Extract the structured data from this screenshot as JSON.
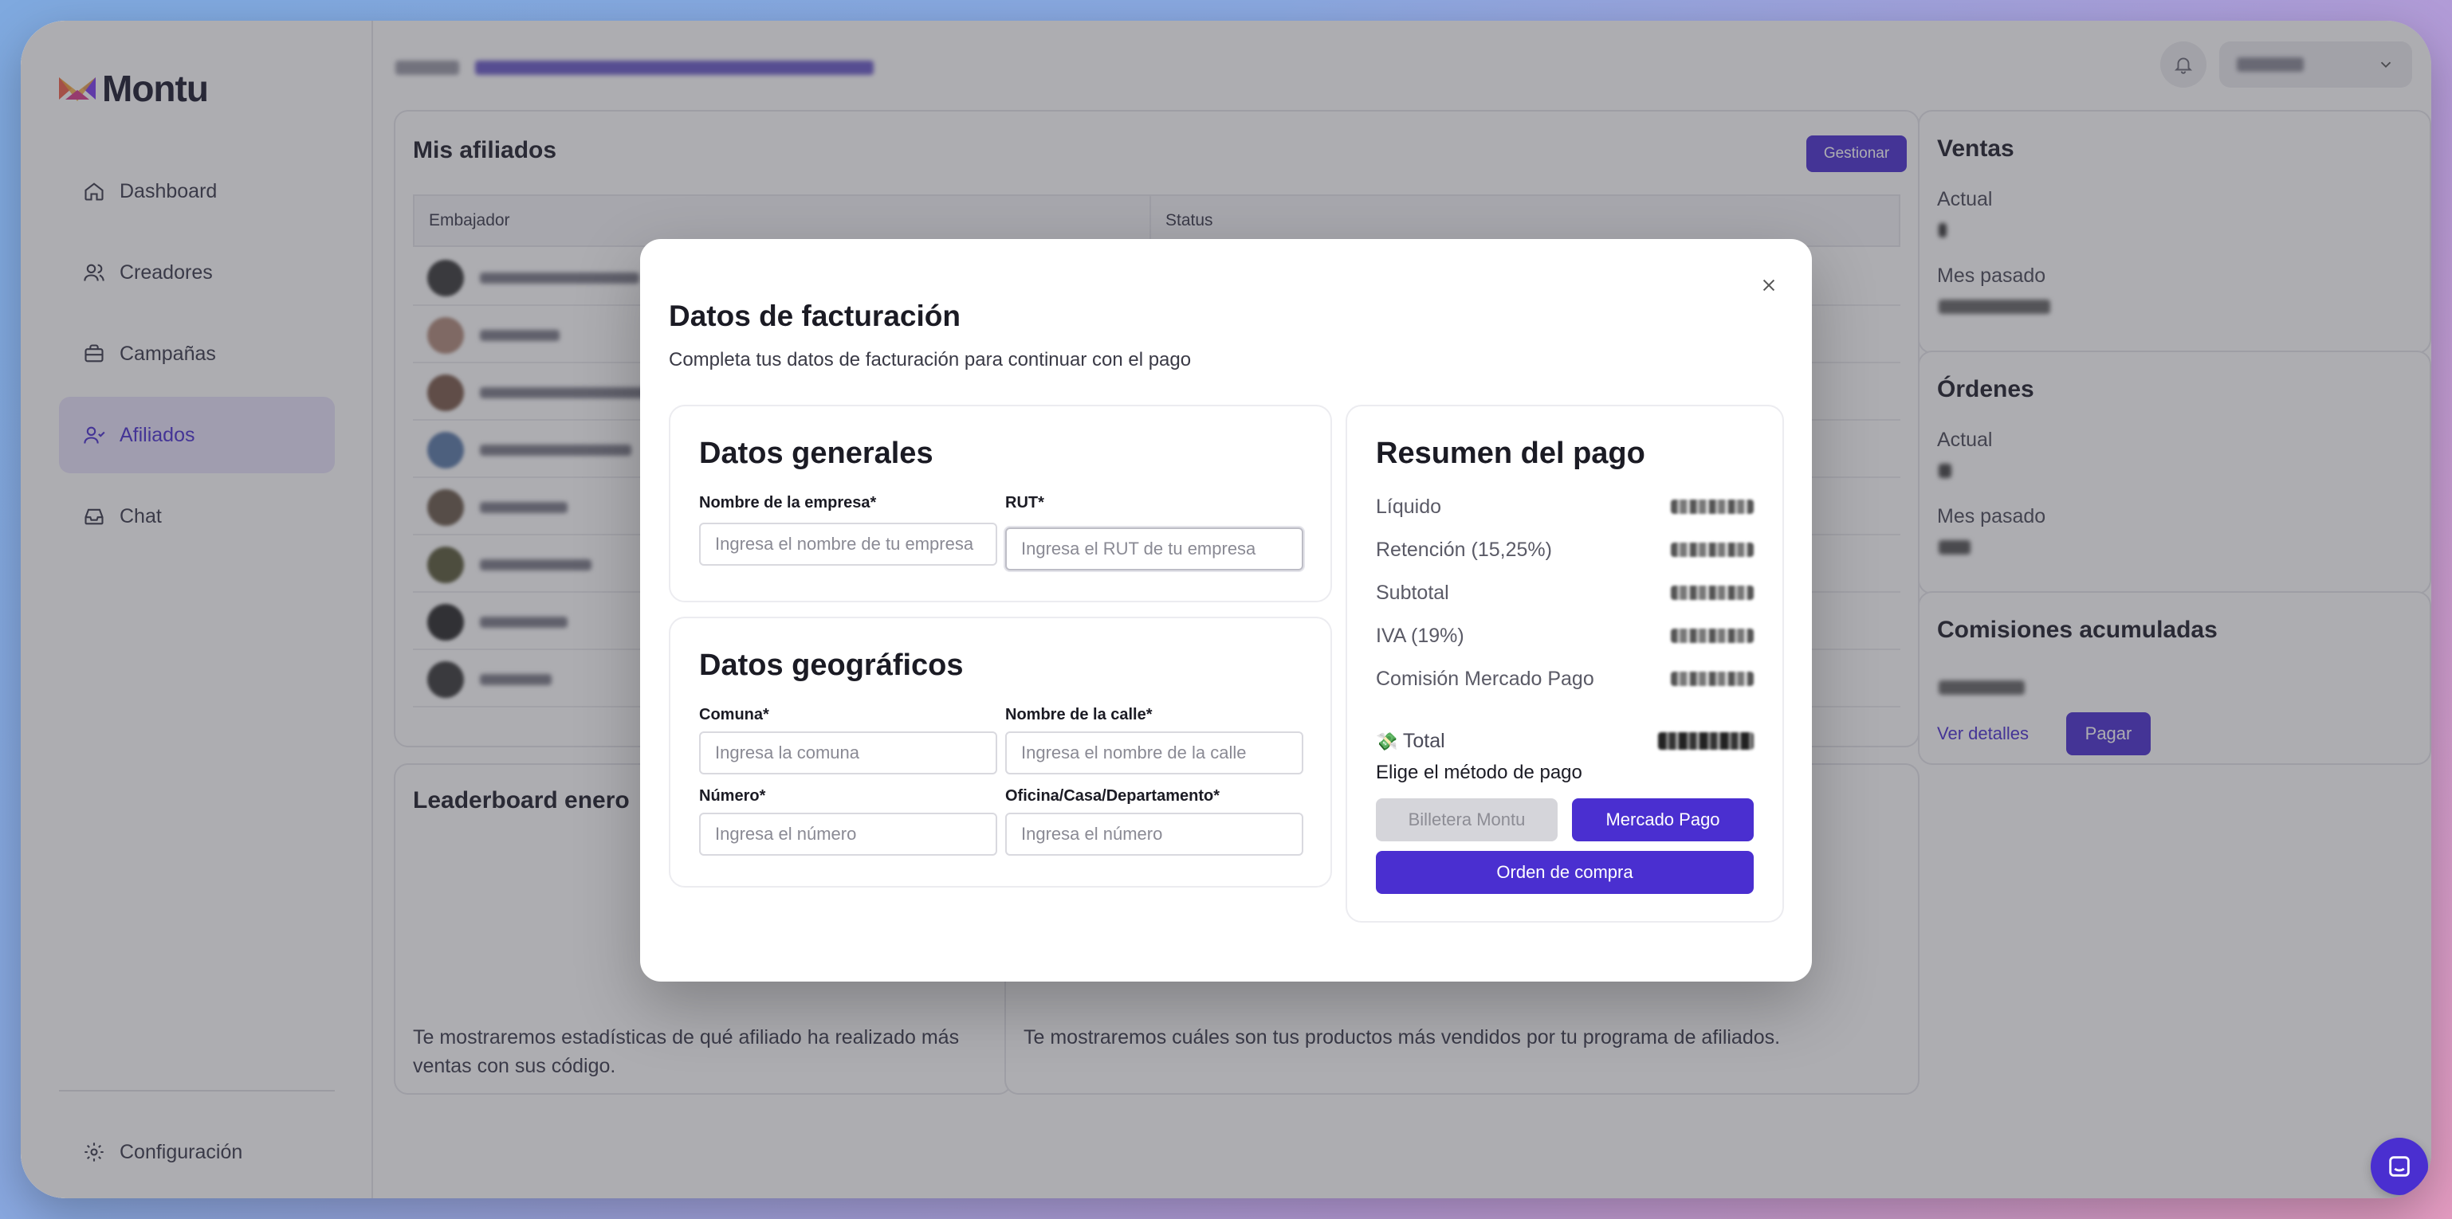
{
  "app": {
    "brand": "Montu",
    "accent_color": "#4a2fd0"
  },
  "sidebar": {
    "items": [
      {
        "label": "Dashboard",
        "icon": "home-icon",
        "active": false
      },
      {
        "label": "Creadores",
        "icon": "users-icon",
        "active": false
      },
      {
        "label": "Campañas",
        "icon": "briefcase-icon",
        "active": false
      },
      {
        "label": "Afiliados",
        "icon": "user-link-icon",
        "active": true
      },
      {
        "label": "Chat",
        "icon": "inbox-icon",
        "active": false
      }
    ],
    "settings_label": "Configuración"
  },
  "topbar": {
    "bell_icon": "bell-icon",
    "user_menu_icon": "chevron-down-icon"
  },
  "affiliates": {
    "title": "Mis afiliados",
    "manage_label": "Gestionar",
    "columns": [
      "Embajador",
      "Status"
    ],
    "row_count": 8
  },
  "leaderboard": {
    "title": "Leaderboard enero",
    "description": "Te mostraremos estadísticas de qué afiliado ha realizado más ventas con sus código."
  },
  "products": {
    "description": "Te mostraremos cuáles son tus productos más vendidos por tu programa de afiliados."
  },
  "ventas": {
    "title": "Ventas",
    "actual_label": "Actual",
    "previous_label": "Mes pasado"
  },
  "ordenes": {
    "title": "Órdenes",
    "actual_label": "Actual",
    "previous_label": "Mes pasado"
  },
  "comisiones": {
    "title": "Comisiones acumuladas",
    "details_label": "Ver detalles",
    "pay_label": "Pagar"
  },
  "modal": {
    "title": "Datos de facturación",
    "subtitle": "Completa tus datos de facturación para continuar con el pago",
    "close_icon": "close-icon",
    "general": {
      "title": "Datos generales",
      "company_label": "Nombre de la empresa*",
      "company_placeholder": "Ingresa el nombre de tu empresa",
      "rut_label": "RUT*",
      "rut_placeholder": "Ingresa el RUT de tu empresa"
    },
    "geo": {
      "title": "Datos geográficos",
      "comuna_label": "Comuna*",
      "comuna_placeholder": "Ingresa la comuna",
      "street_label": "Nombre de la calle*",
      "street_placeholder": "Ingresa el nombre de la calle",
      "number_label": "Número*",
      "number_placeholder": "Ingresa el número",
      "office_label": "Oficina/Casa/Departamento*",
      "office_placeholder": "Ingresa el número"
    },
    "summary": {
      "title": "Resumen del pago",
      "rows": [
        {
          "label": "Líquido"
        },
        {
          "label": "Retención (15,25%)"
        },
        {
          "label": "Subtotal"
        },
        {
          "label": "IVA (19%)"
        },
        {
          "label": "Comisión Mercado Pago"
        }
      ],
      "total_emoji": "💸",
      "total_label": "Total",
      "method_label": "Elige el método de pago",
      "wallet_label": "Billetera Montu",
      "mp_label": "Mercado Pago",
      "order_label": "Orden de compra"
    }
  },
  "chat_widget_icon": "chat-icon"
}
